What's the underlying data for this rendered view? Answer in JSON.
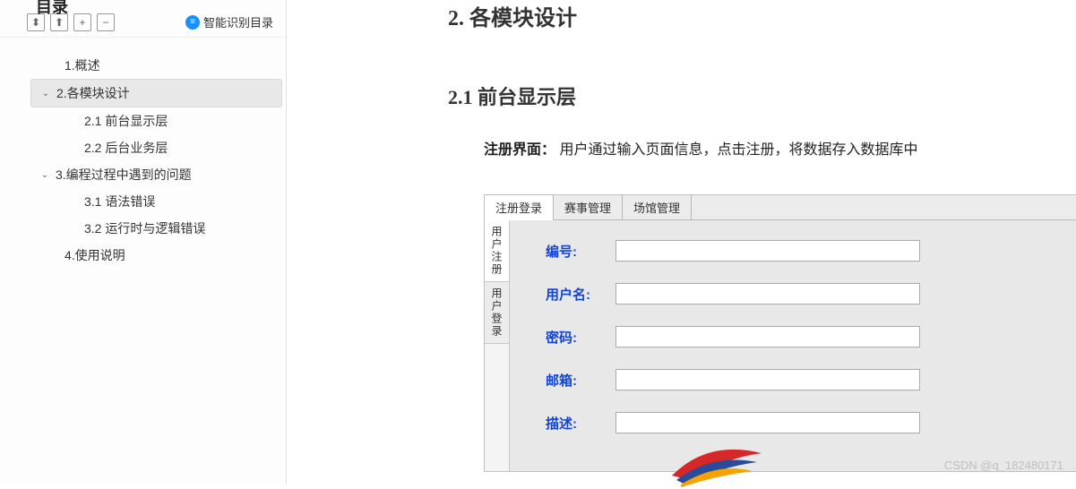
{
  "sidebar": {
    "toc_title": "目录",
    "smart_label": "智能识别目录",
    "buttons": {
      "a": "⬍",
      "b": "⬆",
      "c": "+",
      "d": "−"
    },
    "items": [
      {
        "label": "1.概述",
        "level": 1,
        "expanded": null,
        "selected": false
      },
      {
        "label": "2.各模块设计",
        "level": 0,
        "expanded": true,
        "selected": true
      },
      {
        "label": "2.1 前台显示层",
        "level": 2,
        "expanded": null,
        "selected": false
      },
      {
        "label": "2.2 后台业务层",
        "level": 2,
        "expanded": null,
        "selected": false
      },
      {
        "label": "3.编程过程中遇到的问题",
        "level": 0,
        "expanded": true,
        "selected": false
      },
      {
        "label": "3.1  语法错误",
        "level": 2,
        "expanded": null,
        "selected": false
      },
      {
        "label": "3.2  运行时与逻辑错误",
        "level": 2,
        "expanded": null,
        "selected": false
      },
      {
        "label": "4.使用说明",
        "level": 1,
        "expanded": null,
        "selected": false
      }
    ]
  },
  "document": {
    "h2": "2. 各模块设计",
    "h3": "2.1 前台显示层",
    "body_label": "注册界面：",
    "body_text": "用户通过输入页面信息，点击注册，将数据存入数据库中",
    "form": {
      "tabs_h": [
        "注册登录",
        "赛事管理",
        "场馆管理"
      ],
      "tabs_v": [
        "用户注册",
        "用户登录"
      ],
      "fields": [
        {
          "label": "编号:"
        },
        {
          "label": "用户名:"
        },
        {
          "label": "密码:"
        },
        {
          "label": "邮箱:"
        },
        {
          "label": "描述:"
        }
      ]
    }
  },
  "watermark": "CSDN @q_182480171"
}
